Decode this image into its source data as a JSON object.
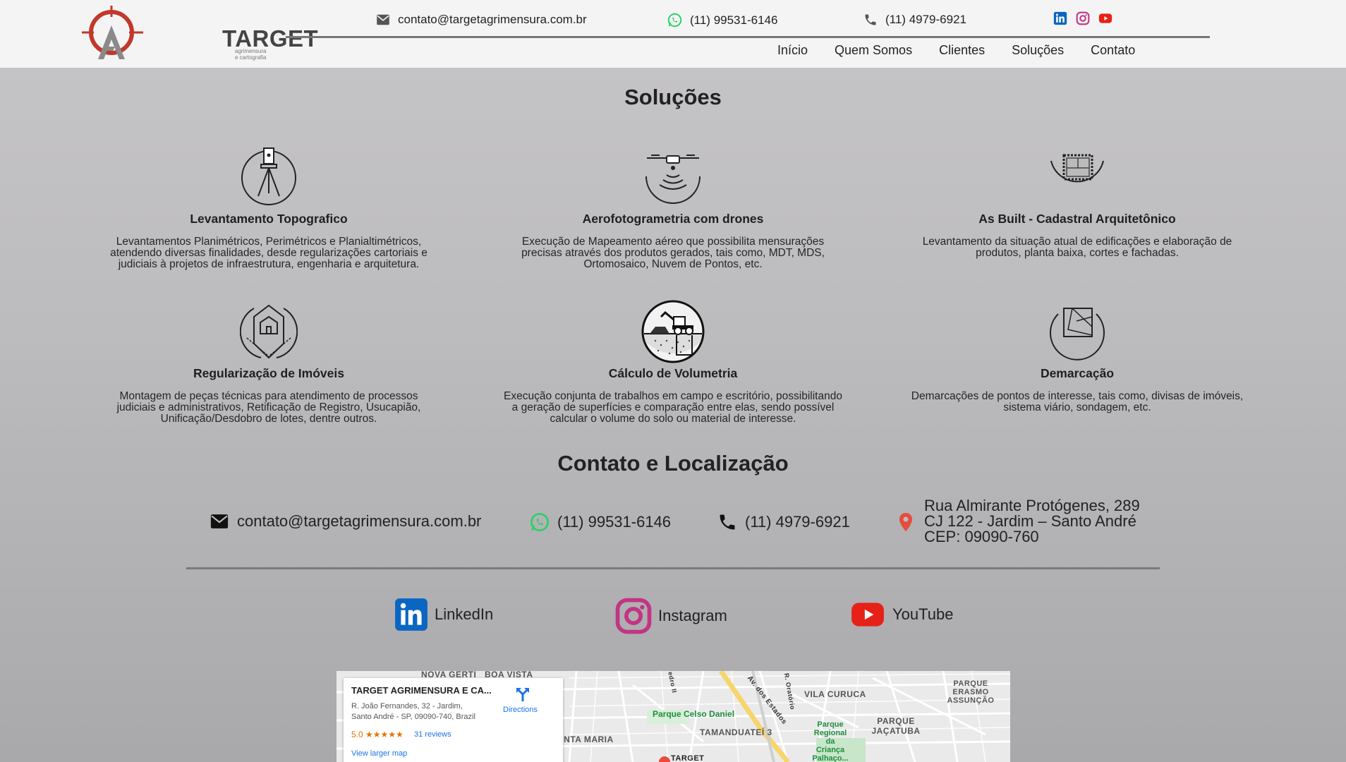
{
  "header": {
    "logo": {
      "name": "TARGET",
      "tagline": "agrimensura e cartografia"
    },
    "email": "contato@targetagrimensura.com.br",
    "whatsapp": "(11) 99531-6146",
    "phone": "(11) 4979-6921",
    "social_icons": [
      "linkedin-icon",
      "instagram-icon",
      "youtube-icon"
    ],
    "nav": [
      "Início",
      "Quem Somos",
      "Clientes",
      "Soluções",
      "Contato"
    ]
  },
  "solutions": {
    "title": "Soluções",
    "items": [
      {
        "title": "Levantamento Topografico",
        "desc": "Levantamentos Planimétricos, Perimétricos e Planialtimétricos, atendendo diversas finalidades, desde regularizações cartoriais e judiciais à projetos de infraestrutura, engenharia e arquitetura.",
        "icon": "tripod-icon"
      },
      {
        "title": "Aerofotogrametria com drones",
        "desc": "Execução de Mapeamento aéreo que possibilita mensurações precisas através dos produtos gerados, tais como, MDT, MDS, Ortomosaico, Nuvem de Pontos, etc.",
        "icon": "drone-icon"
      },
      {
        "title": "As Built - Cadastral Arquitetônico",
        "desc": "Levantamento da situação atual de edificações e elaboração de produtos, planta baixa, cortes e fachadas.",
        "icon": "floorplan-icon"
      },
      {
        "title": "Regularização de Imóveis",
        "desc": "Montagem de peças técnicas para atendimento de processos judiciais e administrativos, Retificação de Registro, Usucapião, Unificação/Desdobro de lotes, dentre outros.",
        "icon": "property-icon"
      },
      {
        "title": "Cálculo de Volumetria",
        "desc": "Execução conjunta de trabalhos em campo e escritório, possibilitando a geração de superfícies e comparação entre elas, sendo possível calcular o volume do solo ou material de interesse.",
        "icon": "excavator-icon"
      },
      {
        "title": "Demarcação",
        "desc": "Demarcações de pontos de interesse, tais como, divisas de imóveis, sistema viário, sondagem, etc.",
        "icon": "boundary-icon"
      }
    ]
  },
  "contact": {
    "title": "Contato e Localização",
    "email": "contato@targetagrimensura.com.br",
    "whatsapp": "(11) 99531-6146",
    "phone": "(11) 4979-6921",
    "address_line1": "Rua Almirante Protógenes, 289",
    "address_line2": "CJ 122 - Jardim – Santo André",
    "address_line3": "CEP: 09090-760",
    "social": {
      "linkedin": "LinkedIn",
      "instagram": "Instagram",
      "youtube": "YouTube"
    }
  },
  "map": {
    "place_name": "TARGET AGRIMENSURA E CA...",
    "address1": "R. João Fernandes, 32 - Jardim,",
    "address2": "Santo André - SP, 09090-740, Brazil",
    "rating": "5.0 ★★★★★",
    "reviews": "31 reviews",
    "directions": "Directions",
    "view_larger": "View larger map",
    "pin_label": "TARGET",
    "labels": [
      "NOVA GERTI",
      "BOA VISTA",
      "VILA CURUCA",
      "PARQUE ERASMO ASSUNÇÃO",
      "TAMANDUATEÍ 3",
      "PARQUE JAÇATUBA",
      "ANTA MARIA"
    ],
    "parks": [
      "Parque Celso Daniel",
      "Parque Regional da Criança Palhaço..."
    ],
    "streets": [
      "Av. dos Estados",
      "Pedro II",
      "R. Oratório"
    ]
  },
  "colors": {
    "whatsapp": "#25d366",
    "linkedin": "#0a66c2",
    "instagram": "#c13584",
    "youtube": "#e62117",
    "pin": "#e74c3c",
    "logo_red": "#c0392b"
  }
}
